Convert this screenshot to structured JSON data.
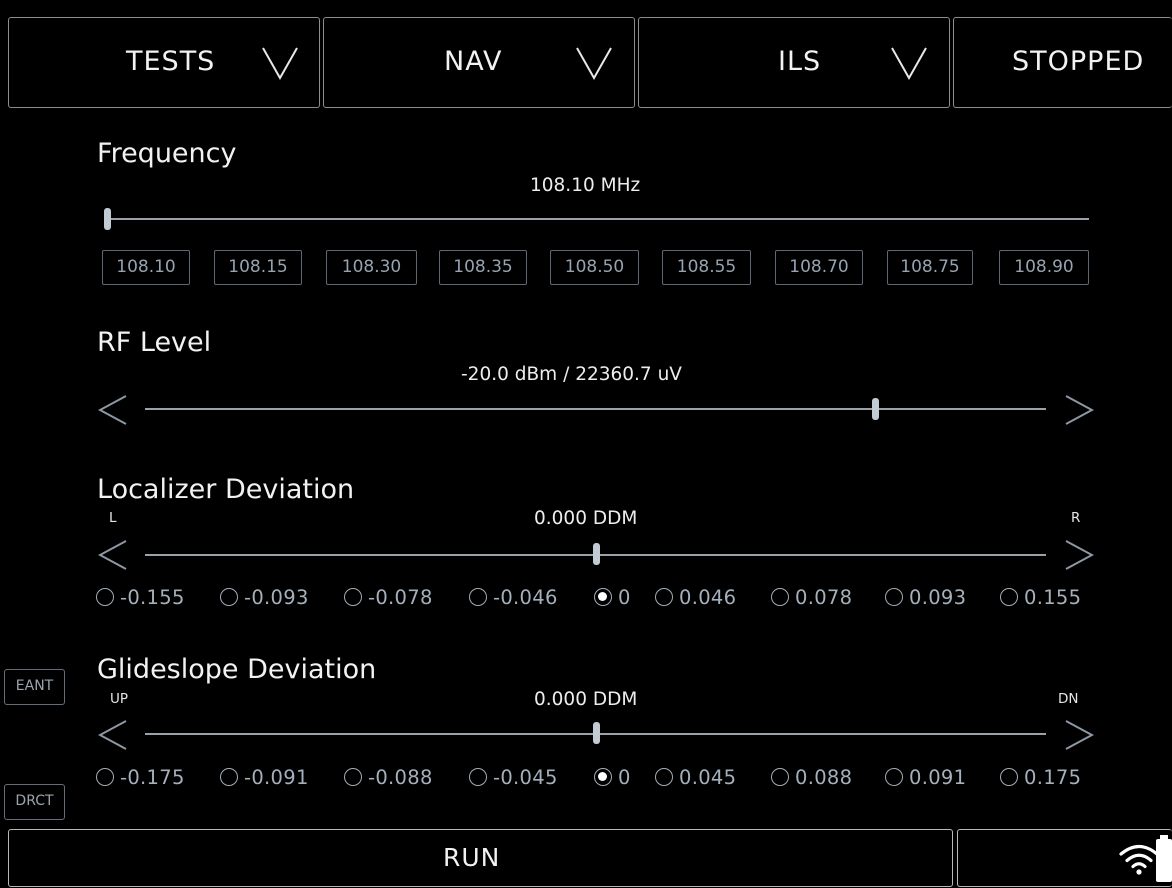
{
  "menu": {
    "tests": "TESTS",
    "nav": "NAV",
    "ils": "ILS",
    "status": "STOPPED"
  },
  "icons": {
    "dropdown": "chevron-down-icon",
    "left": "chevron-left-icon",
    "right": "chevron-right-icon",
    "wifi": "wifi-icon",
    "battery": "battery-icon"
  },
  "frequency": {
    "title": "Frequency",
    "readout": "108.10 MHz",
    "position": 0.0,
    "presets": [
      "108.10",
      "108.15",
      "108.30",
      "108.35",
      "108.50",
      "108.55",
      "108.70",
      "108.75",
      "108.90"
    ]
  },
  "rf_level": {
    "title": "RF Level",
    "readout": "-20.0 dBm / 22360.7 uV",
    "position": 0.807
  },
  "localizer": {
    "title": "Localizer Deviation",
    "left_label": "L",
    "right_label": "R",
    "readout": "0.000 DDM",
    "position": 0.5,
    "options": [
      "-0.155",
      "-0.093",
      "-0.078",
      "-0.046",
      "0",
      "0.046",
      "0.078",
      "0.093",
      "0.155"
    ],
    "selected": 4
  },
  "glideslope": {
    "title": "Glideslope Deviation",
    "left_label": "UP",
    "right_label": "DN",
    "readout": "0.000 DDM",
    "position": 0.5,
    "options": [
      "-0.175",
      "-0.091",
      "-0.088",
      "-0.045",
      "0",
      "0.045",
      "0.088",
      "0.091",
      "0.175"
    ],
    "selected": 4
  },
  "side": {
    "eant": "EANT",
    "drct": "DRCT"
  },
  "bottom": {
    "run": "RUN"
  },
  "colors": {
    "background": "#000000",
    "track": "#9aa1ab",
    "thumb": "#c2cad4",
    "muted_text": "#a4b0bc"
  }
}
